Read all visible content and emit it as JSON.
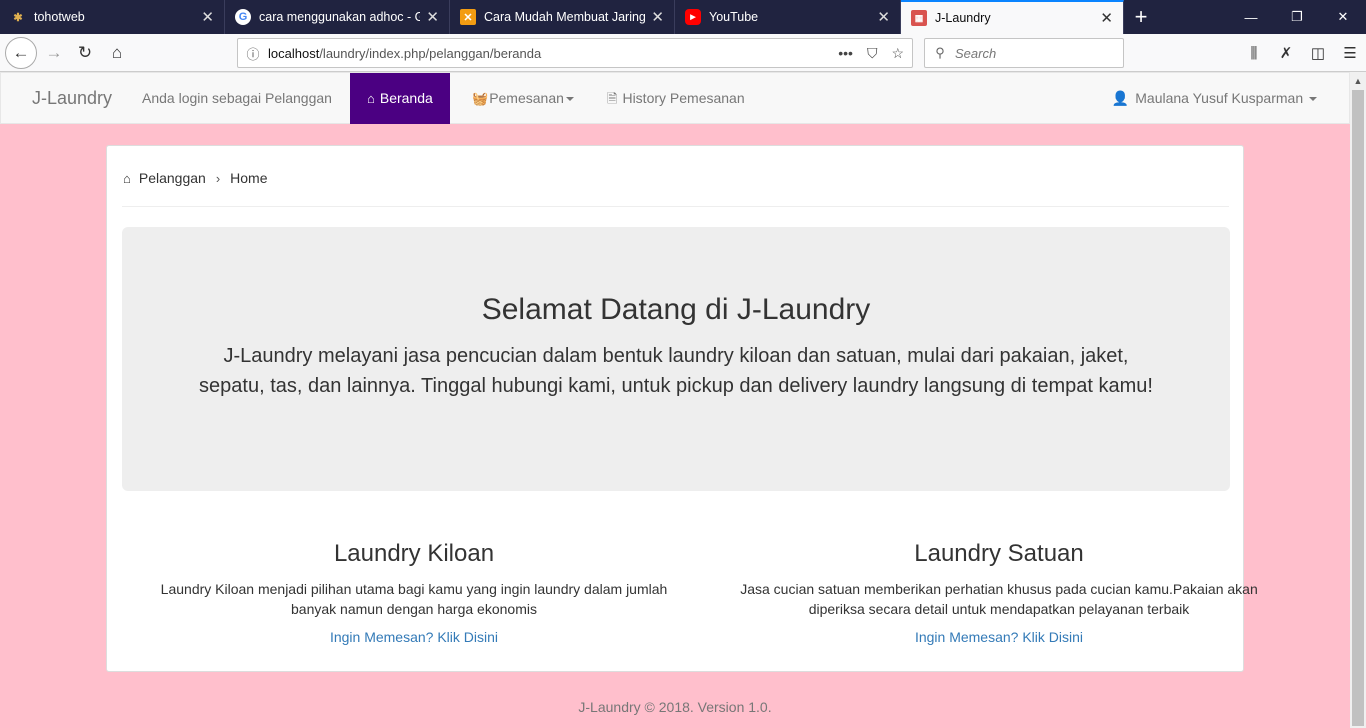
{
  "browser": {
    "tabs": [
      {
        "title": "tohotweb",
        "favicon": "tohotweb-icon"
      },
      {
        "title": "cara menggunakan adhoc - Go",
        "favicon": "google-icon"
      },
      {
        "title": "Cara Mudah Membuat Jaringa",
        "favicon": "x-logo-icon"
      },
      {
        "title": "YouTube",
        "favicon": "youtube-icon"
      },
      {
        "title": "J-Laundry",
        "favicon": "jlaundry-icon"
      }
    ],
    "url_host": "localhost",
    "url_path": "/laundry/index.php/pelanggan/beranda",
    "search_placeholder": "Search",
    "accent_color": "#0a84ff"
  },
  "navbar": {
    "brand": "J-Laundry",
    "login_text": "Anda login sebagai Pelanggan",
    "items": [
      {
        "label": "Beranda",
        "icon": "home-icon",
        "active": true
      },
      {
        "label": "Pemesanan",
        "icon": "basket-icon",
        "dropdown": true
      },
      {
        "label": "History Pemesanan",
        "icon": "document-icon"
      }
    ],
    "user": "Maulana Yusuf Kusparman",
    "active_color": "#4b0082"
  },
  "breadcrumb": [
    "Pelanggan",
    "Home"
  ],
  "jumbotron": {
    "title": "Selamat Datang di J-Laundry",
    "text": "J-Laundry melayani jasa pencucian dalam bentuk laundry kiloan dan satuan, mulai dari pakaian, jaket, sepatu, tas, dan lainnya. Tinggal hubungi kami, untuk pickup dan delivery laundry langsung di tempat kamu!"
  },
  "services": [
    {
      "title": "Laundry Kiloan",
      "text": "Laundry Kiloan menjadi pilihan utama bagi kamu yang ingin laundry dalam jumlah banyak namun dengan harga ekonomis",
      "link": "Ingin Memesan? Klik Disini"
    },
    {
      "title": "Laundry Satuan",
      "text": "Jasa cucian satuan memberikan perhatian khusus pada cucian kamu.Pakaian akan diperiksa secara detail untuk mendapatkan pelayanan terbaik",
      "link": "Ingin Memesan? Klik Disini"
    }
  ],
  "footer": "J-Laundry © 2018. Version 1.0.",
  "page_background": "#ffbfcc"
}
